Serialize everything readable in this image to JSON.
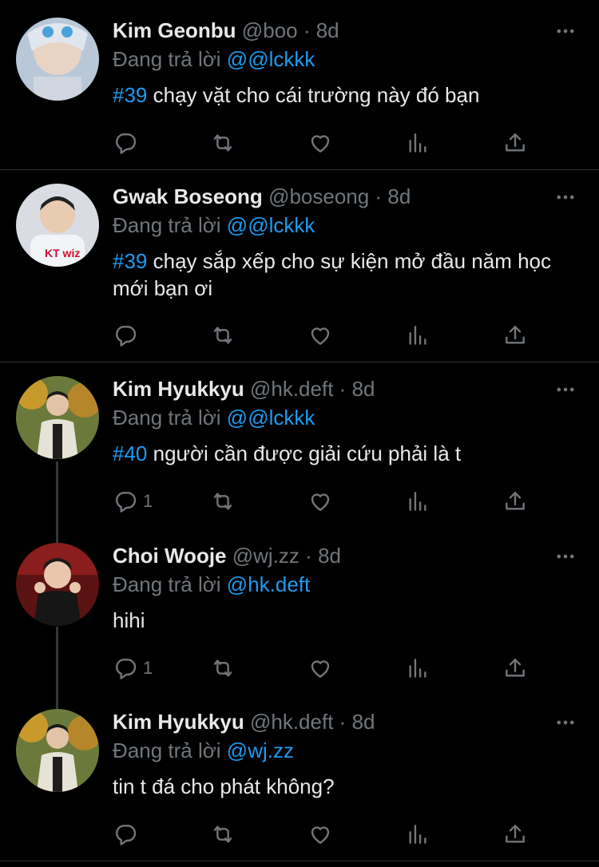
{
  "tweets": [
    {
      "name": "Kim Geonbu",
      "handle": "@boo",
      "sep": "·",
      "time": "8d",
      "replying_prefix": "Đang trả lời",
      "replying_to": "@@lckkk",
      "tag": "#39",
      "text": " chạy vặt cho cái trường này đó bạn",
      "reply_count": "",
      "avatar_icon": "avatar-kim-geonbu"
    },
    {
      "name": "Gwak Boseong",
      "handle": "@boseong",
      "sep": "·",
      "time": "8d",
      "replying_prefix": "Đang trả lời",
      "replying_to": "@@lckkk",
      "tag": "#39",
      "text": " chạy sắp xếp cho sự kiện mở đầu năm học mới bạn ơi",
      "reply_count": "",
      "avatar_icon": "avatar-gwak-boseong"
    },
    {
      "name": "Kim Hyukkyu",
      "handle": "@hk.deft",
      "sep": "·",
      "time": "8d",
      "replying_prefix": "Đang trả lời",
      "replying_to": "@@lckkk",
      "tag": "#40",
      "text": " người cần được giải cứu phải là t",
      "reply_count": "1",
      "avatar_icon": "avatar-kim-hyukkyu"
    },
    {
      "name": "Choi Wooje",
      "handle": "@wj.zz",
      "sep": "·",
      "time": "8d",
      "replying_prefix": "Đang trả lời",
      "replying_to": "@hk.deft",
      "tag": "",
      "text": "hihi",
      "reply_count": "1",
      "avatar_icon": "avatar-choi-wooje"
    },
    {
      "name": "Kim Hyukkyu",
      "handle": "@hk.deft",
      "sep": "·",
      "time": "8d",
      "replying_prefix": "Đang trả lời",
      "replying_to": "@wj.zz",
      "tag": "",
      "text": "tin t đá cho phát không?",
      "reply_count": "",
      "avatar_icon": "avatar-kim-hyukkyu"
    }
  ],
  "colors": {
    "background": "#000000",
    "text": "#e7e9ea",
    "muted": "#71767b",
    "accent": "#1d9bf0",
    "divider": "#2f3336"
  }
}
